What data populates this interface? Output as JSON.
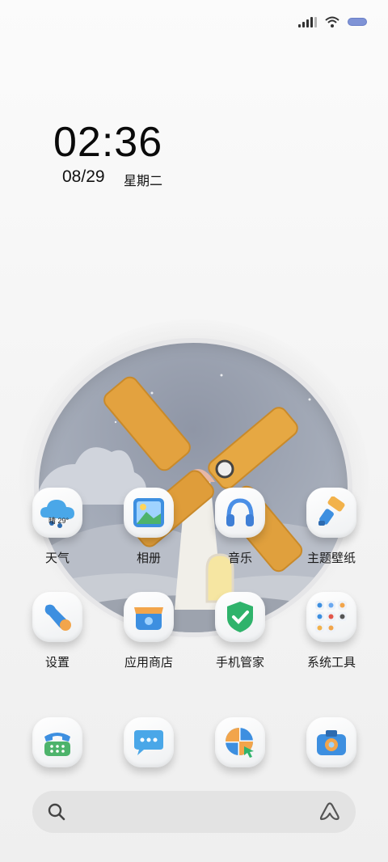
{
  "status_bar": {
    "signal_icon": "cellular-signal-icon",
    "wifi_icon": "wifi-icon",
    "battery_icon": "battery-icon",
    "battery_color": "#7f93d6"
  },
  "lock_clock": {
    "time": "02:36",
    "date": "08/29",
    "weekday": "星期二"
  },
  "apps": [
    {
      "label": "天气",
      "icon": "weather-cloud-icon",
      "detail": "晴 29°"
    },
    {
      "label": "相册",
      "icon": "gallery-picture-icon"
    },
    {
      "label": "音乐",
      "icon": "headphones-icon"
    },
    {
      "label": "主题壁纸",
      "icon": "paintbrush-icon"
    },
    {
      "label": "设置",
      "icon": "wrench-icon"
    },
    {
      "label": "应用商店",
      "icon": "store-bag-icon"
    },
    {
      "label": "手机管家",
      "icon": "shield-check-icon"
    },
    {
      "label": "系统工具",
      "icon": "tools-folder-icon"
    }
  ],
  "dock": [
    {
      "name": "phone",
      "icon": "telephone-icon"
    },
    {
      "name": "messages",
      "icon": "chat-bubble-icon"
    },
    {
      "name": "browser",
      "icon": "compass-browser-icon"
    },
    {
      "name": "camera",
      "icon": "camera-icon"
    }
  ],
  "search": {
    "left_icon": "search-icon",
    "right_icon": "assistant-a-icon"
  },
  "colors": {
    "weather_blue": "#4aa7e8",
    "gallery_blue": "#3d8fe0",
    "shield_green": "#2fb36b",
    "store_orange": "#f2a54b",
    "windmill_wood": "#e3a23f"
  }
}
